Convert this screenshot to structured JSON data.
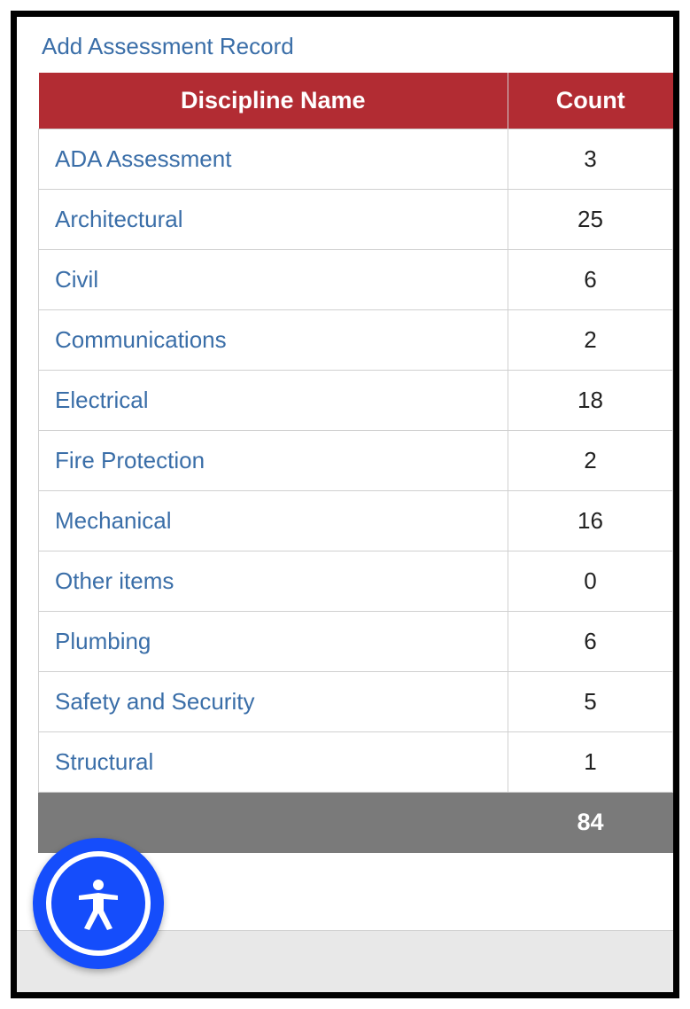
{
  "addLink": "Add Assessment Record",
  "table": {
    "headers": {
      "name": "Discipline Name",
      "count": "Count"
    },
    "rows": [
      {
        "name": "ADA Assessment",
        "count": "3"
      },
      {
        "name": "Architectural",
        "count": "25"
      },
      {
        "name": "Civil",
        "count": "6"
      },
      {
        "name": "Communications",
        "count": "2"
      },
      {
        "name": "Electrical",
        "count": "18"
      },
      {
        "name": "Fire Protection",
        "count": "2"
      },
      {
        "name": "Mechanical",
        "count": "16"
      },
      {
        "name": "Other items",
        "count": "0"
      },
      {
        "name": "Plumbing",
        "count": "6"
      },
      {
        "name": "Safety and Security",
        "count": "5"
      },
      {
        "name": "Structural",
        "count": "1"
      }
    ],
    "total": "84"
  }
}
